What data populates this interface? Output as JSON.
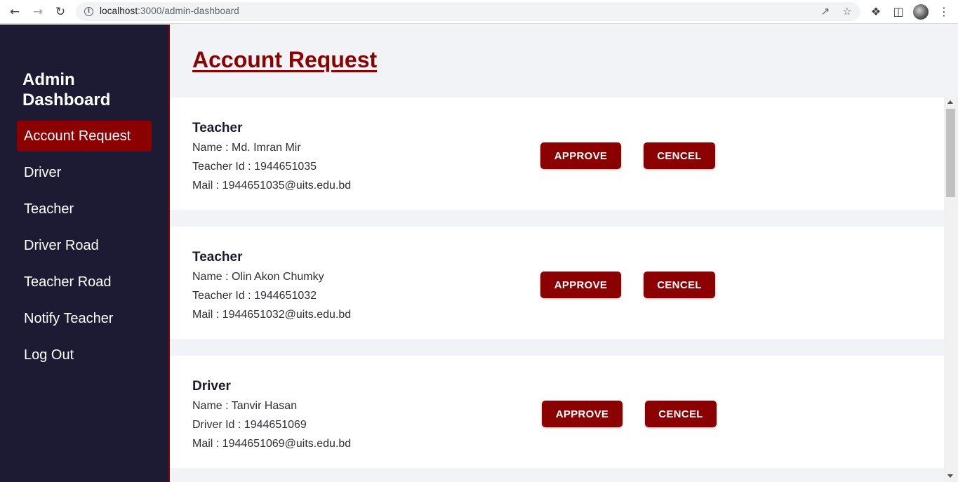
{
  "browser": {
    "url_host": "localhost",
    "url_path": ":3000/admin-dashboard",
    "back_icon": "arrow-left",
    "forward_icon": "arrow-right",
    "reload_icon": "reload"
  },
  "sidebar": {
    "title": "Admin Dashboard",
    "items": [
      {
        "label": "Account Request",
        "active": true
      },
      {
        "label": "Driver"
      },
      {
        "label": "Teacher"
      },
      {
        "label": "Driver Road"
      },
      {
        "label": "Teacher Road"
      },
      {
        "label": "Notify Teacher"
      },
      {
        "label": "Log Out"
      }
    ]
  },
  "main": {
    "title": "Account Request",
    "requests": [
      {
        "role": "Teacher",
        "name": "Name : Md. Imran Mir",
        "id": "Teacher Id : 1944651035",
        "mail": "Mail : 1944651035@uits.edu.bd",
        "approve": "APPROVE",
        "cancel": "CENCEL"
      },
      {
        "role": "Teacher",
        "name": "Name : Olin Akon Chumky",
        "id": "Teacher Id : 1944651032",
        "mail": "Mail : 1944651032@uits.edu.bd",
        "approve": "APPROVE",
        "cancel": "CENCEL"
      },
      {
        "role": "Driver",
        "name": "Name : Tanvir Hasan",
        "id": "Driver Id : 1944651069",
        "mail": "Mail : 1944651069@uits.edu.bd",
        "approve": "APPROVE",
        "cancel": "CENCEL"
      }
    ]
  },
  "colors": {
    "accent": "#8b0000",
    "sidebar_bg": "#1c1b33",
    "page_bg": "#f1f3f6"
  }
}
